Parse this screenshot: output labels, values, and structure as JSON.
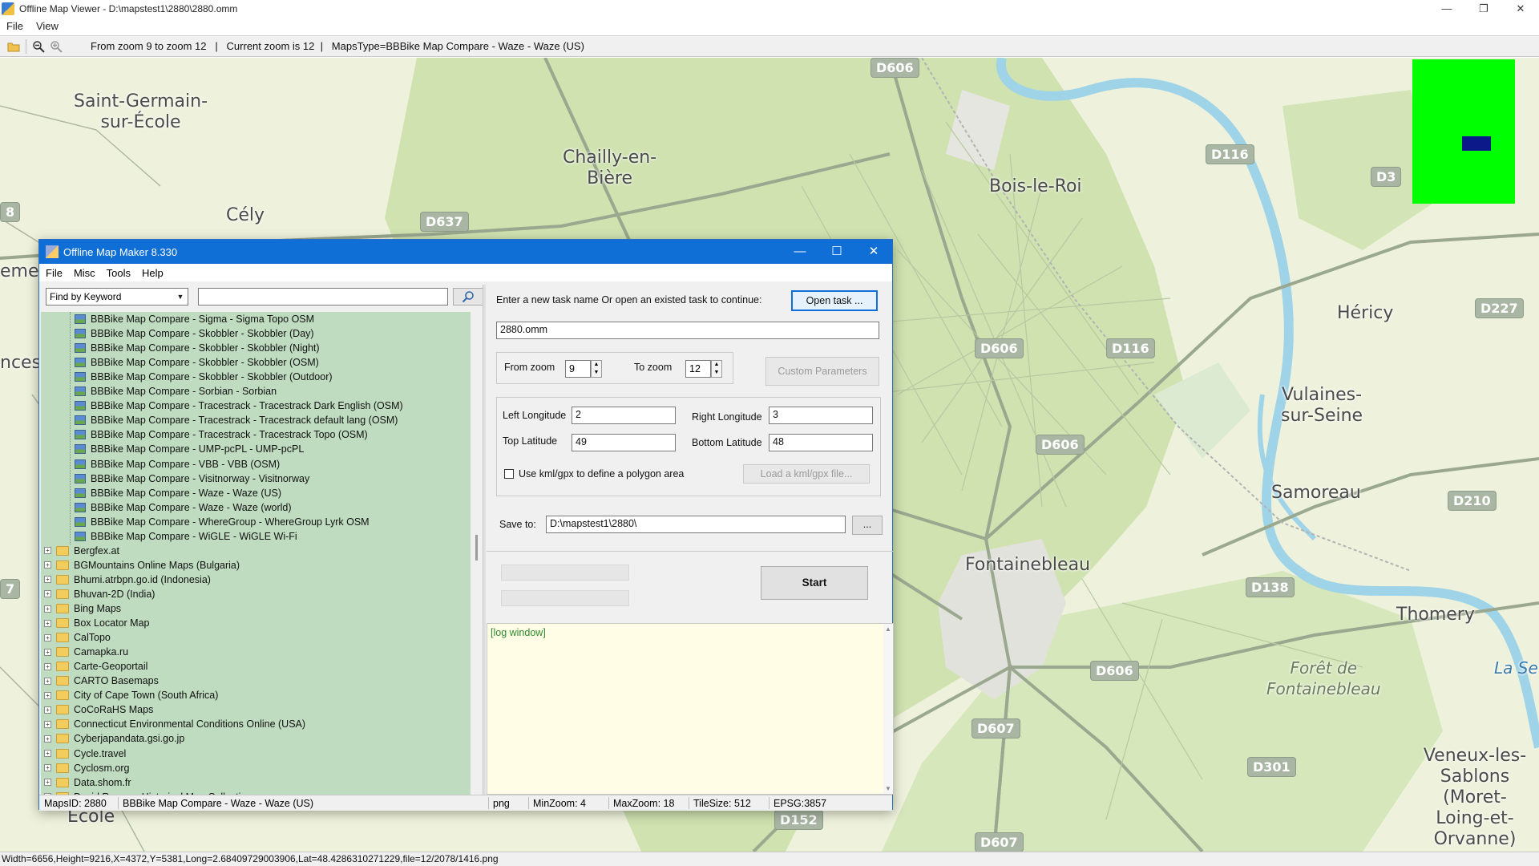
{
  "viewer": {
    "title": "Offline Map Viewer - D:\\mapstest1\\2880\\2880.omm",
    "menu": [
      "File",
      "View"
    ],
    "toolbar_status": "From zoom 9 to zoom 12   |   Current zoom is 12  |   MapsType=BBBike Map Compare - Waze - Waze (US)",
    "statusbar": "Width=6656,Height=9216,X=4372,Y=5381,Long=2.68409729003906,Lat=48.4286310271229,file=12/2078/1416.png",
    "window_controls": [
      "—",
      "❐",
      "✕"
    ]
  },
  "map": {
    "places": [
      {
        "name": "Saint-Germain-\nsur-École",
        "kind": "town"
      },
      {
        "name": "Chailly-en-\nBière",
        "kind": "town"
      },
      {
        "name": "Cély",
        "kind": "town"
      },
      {
        "name": "Bois-le-Roi",
        "kind": "town"
      },
      {
        "name": "Héricy",
        "kind": "town"
      },
      {
        "name": "Vulaines-\nsur-Seine",
        "kind": "town"
      },
      {
        "name": "Samoreau",
        "kind": "town"
      },
      {
        "name": "Fontainebleau",
        "kind": "town"
      },
      {
        "name": "Thomery",
        "kind": "town"
      },
      {
        "name": "Forêt de\nFontainebleau",
        "kind": "forest"
      },
      {
        "name": "Veneux-les-\nSablons (Moret-\nLoing-et-\nOrvanne)",
        "kind": "town"
      },
      {
        "name": "La Se",
        "kind": "water"
      },
      {
        "name": "eme",
        "kind": "town"
      },
      {
        "name": "nces",
        "kind": "town"
      },
      {
        "name": "École",
        "kind": "town"
      }
    ],
    "road_shields": [
      "D606",
      "D637",
      "D116",
      "D116",
      "D3",
      "D227",
      "D606",
      "D606",
      "D210",
      "D138",
      "D606",
      "D607",
      "D301",
      "D152",
      "D607",
      "8",
      "7"
    ]
  },
  "dialog": {
    "title": "Offline Map Maker 8.330",
    "menu": [
      "File",
      "Misc",
      "Tools",
      "Help"
    ],
    "window_controls": [
      "—",
      "☐",
      "✕"
    ],
    "search": {
      "mode": "Find by Keyword",
      "value": ""
    },
    "tree": {
      "map_items": [
        "BBBike Map Compare - Sigma - Sigma Topo OSM",
        "BBBike Map Compare - Skobbler - Skobbler (Day)",
        "BBBike Map Compare - Skobbler - Skobbler (Night)",
        "BBBike Map Compare - Skobbler - Skobbler (OSM)",
        "BBBike Map Compare - Skobbler - Skobbler (Outdoor)",
        "BBBike Map Compare - Sorbian - Sorbian",
        "BBBike Map Compare - Tracestrack - Tracestrack Dark English (OSM)",
        "BBBike Map Compare - Tracestrack - Tracestrack default lang (OSM)",
        "BBBike Map Compare - Tracestrack - Tracestrack Topo (OSM)",
        "BBBike Map Compare - UMP-pcPL - UMP-pcPL",
        "BBBike Map Compare - VBB - VBB (OSM)",
        "BBBike Map Compare - Visitnorway - Visitnorway",
        "BBBike Map Compare - Waze - Waze (US)",
        "BBBike Map Compare - Waze - Waze (world)",
        "BBBike Map Compare - WhereGroup - WhereGroup Lyrk OSM",
        "BBBike Map Compare - WiGLE - WiGLE Wi-Fi"
      ],
      "folders": [
        "Bergfex.at",
        "BGMountains Online Maps (Bulgaria)",
        "Bhumi.atrbpn.go.id (Indonesia)",
        "Bhuvan-2D (India)",
        "Bing Maps",
        "Box Locator Map",
        "CalTopo",
        "Camapka.ru",
        "Carte-Geoportail",
        "CARTO Basemaps",
        "City of Cape Town (South Africa)",
        "CoCoRaHS Maps",
        "Connecticut Environmental Conditions Online (USA)",
        "Cyberjapandata.gsi.go.jp",
        "Cycle.travel",
        "Cyclosm.org",
        "Data.shom.fr",
        "David Rumsey Historical Map Collection"
      ]
    },
    "task": {
      "prompt": "Enter a new task name Or open an existed task to continue:",
      "open_button": "Open task ...",
      "name": "2880.omm"
    },
    "zoom": {
      "from_label": "From zoom",
      "from_value": "9",
      "to_label": "To zoom",
      "to_value": "12",
      "custom_button": "Custom Parameters"
    },
    "bounds": {
      "left_label": "Left Longitude",
      "left_value": "2",
      "right_label": "Right Longitude",
      "right_value": "3",
      "top_label": "Top Latitude",
      "top_value": "49",
      "bottom_label": "Bottom Latitude",
      "bottom_value": "48",
      "kml_label": "Use kml/gpx to define a polygon area",
      "kml_button": "Load a kml/gpx file..."
    },
    "save": {
      "label": "Save to:",
      "path": "D:\\mapstest1\\2880\\",
      "browse": "..."
    },
    "start_button": "Start",
    "log": "[log window]",
    "statusbar": {
      "maps_id": "MapsID: 2880",
      "maps_name": "BBBike Map Compare - Waze - Waze (US)",
      "format": "png",
      "min_zoom": "MinZoom: 4",
      "max_zoom": "MaxZoom: 18",
      "tile_size": "TileSize: 512",
      "epsg": "EPSG:3857"
    }
  },
  "colors": {
    "map_land": "#eef2dc",
    "map_forest": "#cfe2b0",
    "map_water": "#9fd3e8",
    "road": "#9aa88f",
    "tree_bg": "#bfdcc0",
    "dialog_title": "#0f6fd6",
    "overview_green": "#00ff00",
    "overview_rect": "#0b1a88",
    "log_bg": "#fffde6"
  }
}
